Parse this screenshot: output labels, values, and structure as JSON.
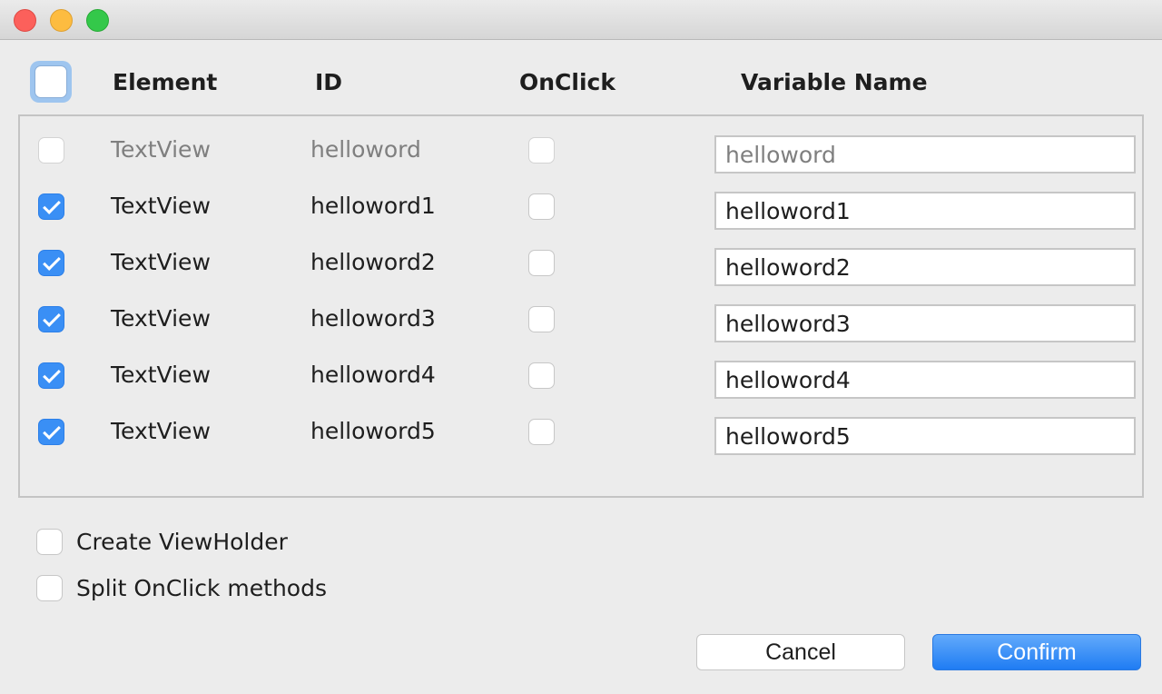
{
  "header": {
    "element": "Element",
    "id": "ID",
    "onclick": "OnClick",
    "variable_name": "Variable Name"
  },
  "rows": [
    {
      "selected": false,
      "disabled": true,
      "element": "TextView",
      "id": "helloword",
      "onclick": false,
      "variable": "helloword"
    },
    {
      "selected": true,
      "disabled": false,
      "element": "TextView",
      "id": "helloword1",
      "onclick": false,
      "variable": "helloword1"
    },
    {
      "selected": true,
      "disabled": false,
      "element": "TextView",
      "id": "helloword2",
      "onclick": false,
      "variable": "helloword2"
    },
    {
      "selected": true,
      "disabled": false,
      "element": "TextView",
      "id": "helloword3",
      "onclick": false,
      "variable": "helloword3"
    },
    {
      "selected": true,
      "disabled": false,
      "element": "TextView",
      "id": "helloword4",
      "onclick": false,
      "variable": "helloword4"
    },
    {
      "selected": true,
      "disabled": false,
      "element": "TextView",
      "id": "helloword5",
      "onclick": false,
      "variable": "helloword5"
    }
  ],
  "options": {
    "create_viewholder": {
      "label": "Create ViewHolder",
      "checked": false
    },
    "split_onclick": {
      "label": "Split OnClick methods",
      "checked": false
    }
  },
  "buttons": {
    "cancel": "Cancel",
    "confirm": "Confirm"
  },
  "colors": {
    "accent": "#3a8ff5",
    "close": "#fc605b",
    "minimize": "#fdbc40",
    "maximize": "#34c84a"
  }
}
